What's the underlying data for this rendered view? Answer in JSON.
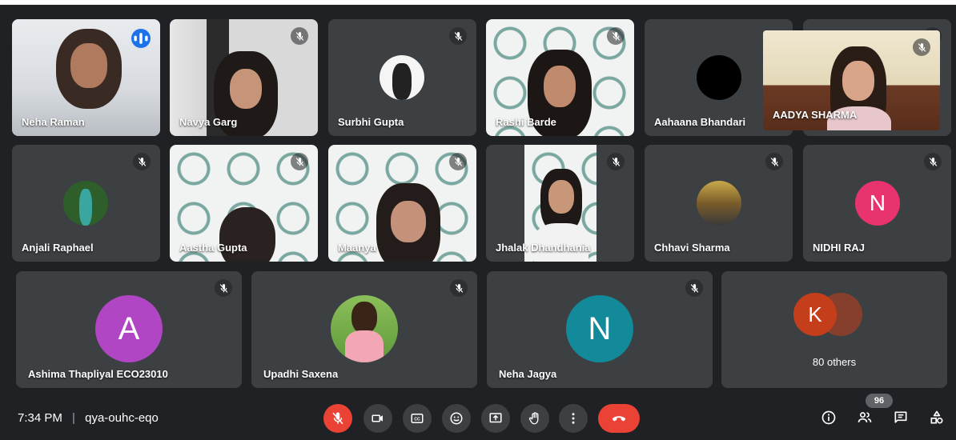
{
  "tiles": [
    {
      "name": "Neha Raman"
    },
    {
      "name": "Navya Garg"
    },
    {
      "name": "Surbhi Gupta"
    },
    {
      "name": "Rashi Barde"
    },
    {
      "name": "Aahaana Bhandari"
    },
    {
      "name": "AADYA SHARMA"
    },
    {
      "name": "Anjali Raphael"
    },
    {
      "name": "Aastha Gupta"
    },
    {
      "name": "Maanya"
    },
    {
      "name": "Jhalak Dhandhania"
    },
    {
      "name": "Chhavi Sharma"
    },
    {
      "name": "NIDHI RAJ",
      "initial": "N",
      "color": "#e8336e"
    },
    {
      "name": "Ashima Thapliyal ECO23010",
      "initial": "A",
      "color": "#b046c3"
    },
    {
      "name": "Upadhi Saxena"
    },
    {
      "name": "Neha Jagya",
      "initial": "N",
      "color": "#128a9a"
    },
    {
      "label": "80 others",
      "initial": "K",
      "color": "#c43e1c"
    }
  ],
  "meeting": {
    "time": "7:34 PM",
    "separator": "|",
    "code": "qya-ouhc-eqo"
  },
  "participants_count": "96",
  "icons": {
    "mic_off": "mic-off-icon",
    "camera": "videocam-icon",
    "captions": "closed-captions-icon",
    "emoji": "emoji-icon",
    "present": "present-screen-icon",
    "raise_hand": "raise-hand-icon",
    "more": "more-vert-icon",
    "end_call": "call-end-icon",
    "info": "info-icon",
    "people": "people-icon",
    "chat": "chat-icon",
    "activities": "activities-icon"
  },
  "colors": {
    "background": "#202124",
    "tile": "#3c4043",
    "end_call": "#ea4335",
    "speaking": "#1a73e8"
  }
}
